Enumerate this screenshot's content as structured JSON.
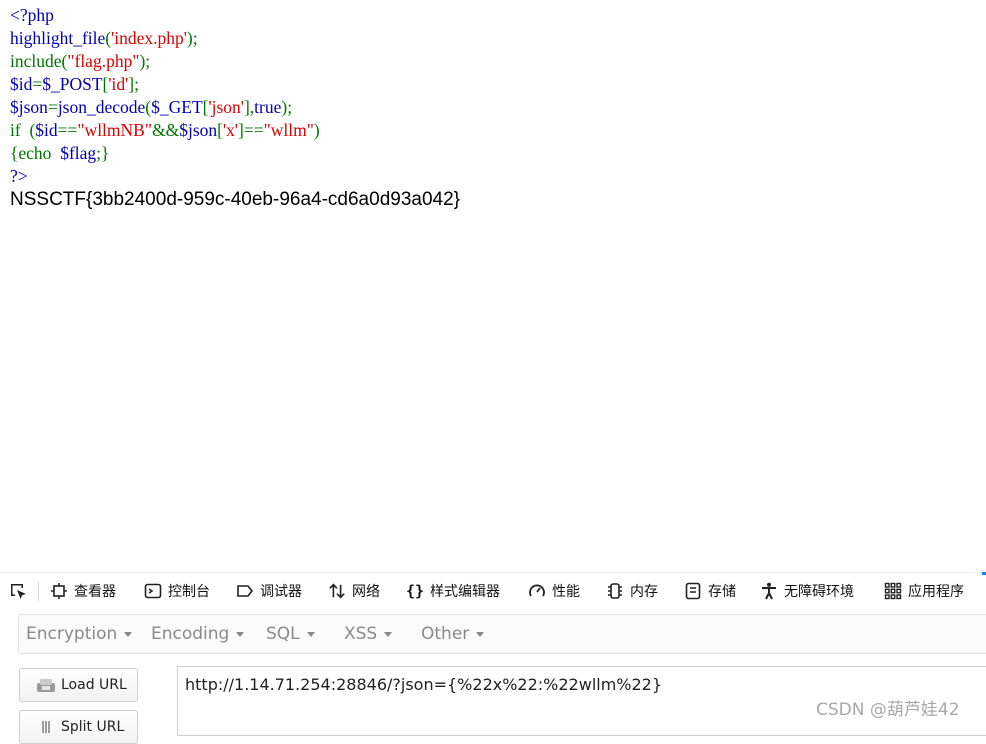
{
  "code_lines": [
    [
      {
        "t": "<?php",
        "c": "b"
      }
    ],
    [
      {
        "t": "highlight_file",
        "c": "b"
      },
      {
        "t": "(",
        "c": "g"
      },
      {
        "t": "'index.php'",
        "c": "r"
      },
      {
        "t": ");",
        "c": "g"
      }
    ],
    [
      {
        "t": "include(",
        "c": "g"
      },
      {
        "t": "\"flag.php\"",
        "c": "r"
      },
      {
        "t": ");",
        "c": "g"
      }
    ],
    [
      {
        "t": "$id",
        "c": "b"
      },
      {
        "t": "=",
        "c": "g"
      },
      {
        "t": "$_POST",
        "c": "b"
      },
      {
        "t": "[",
        "c": "g"
      },
      {
        "t": "'id'",
        "c": "r"
      },
      {
        "t": "];",
        "c": "g"
      }
    ],
    [
      {
        "t": "$json",
        "c": "b"
      },
      {
        "t": "=",
        "c": "g"
      },
      {
        "t": "json_decode",
        "c": "b"
      },
      {
        "t": "(",
        "c": "g"
      },
      {
        "t": "$_GET",
        "c": "b"
      },
      {
        "t": "[",
        "c": "g"
      },
      {
        "t": "'json'",
        "c": "r"
      },
      {
        "t": "],",
        "c": "g"
      },
      {
        "t": "true",
        "c": "b"
      },
      {
        "t": ");",
        "c": "g"
      }
    ],
    [
      {
        "t": "if  (",
        "c": "g"
      },
      {
        "t": "$id",
        "c": "b"
      },
      {
        "t": "==",
        "c": "g"
      },
      {
        "t": "\"wllmNB\"",
        "c": "r"
      },
      {
        "t": "&&",
        "c": "g"
      },
      {
        "t": "$json",
        "c": "b"
      },
      {
        "t": "[",
        "c": "g"
      },
      {
        "t": "'x'",
        "c": "r"
      },
      {
        "t": "]==",
        "c": "g"
      },
      {
        "t": "\"wllm\"",
        "c": "r"
      },
      {
        "t": ")",
        "c": "g"
      }
    ],
    [
      {
        "t": "{echo  ",
        "c": "g"
      },
      {
        "t": "$flag",
        "c": "b"
      },
      {
        "t": ";}",
        "c": "g"
      }
    ],
    [
      {
        "t": "?>",
        "c": "b"
      }
    ]
  ],
  "colors": {
    "b": "#0000bb",
    "g": "#007700",
    "r": "#dd0000"
  },
  "output_text": "NSSCTF{3bb2400d-959c-40eb-96a4-cd6a0d93a042}",
  "devtools": {
    "picker_icon": "element-picker-icon",
    "tabs": [
      {
        "label": "查看器",
        "icon": "inspector-icon"
      },
      {
        "label": "控制台",
        "icon": "console-icon"
      },
      {
        "label": "调试器",
        "icon": "debugger-icon"
      },
      {
        "label": "网络",
        "icon": "network-icon"
      },
      {
        "label": "样式编辑器",
        "icon": "style-editor-icon"
      },
      {
        "label": "性能",
        "icon": "performance-icon"
      },
      {
        "label": "内存",
        "icon": "memory-icon"
      },
      {
        "label": "存储",
        "icon": "storage-icon"
      },
      {
        "label": "无障碍环境",
        "icon": "accessibility-icon"
      },
      {
        "label": "应用程序",
        "icon": "application-icon"
      }
    ]
  },
  "hackbar": {
    "menus": [
      "Encryption",
      "Encoding",
      "SQL",
      "XSS",
      "Other"
    ],
    "load_url_label": "Load URL",
    "split_url_label": "Split URL",
    "url_value": "http://1.14.71.254:28846/?json={%22x%22:%22wllm%22}"
  },
  "watermark": "CSDN @葫芦娃42"
}
